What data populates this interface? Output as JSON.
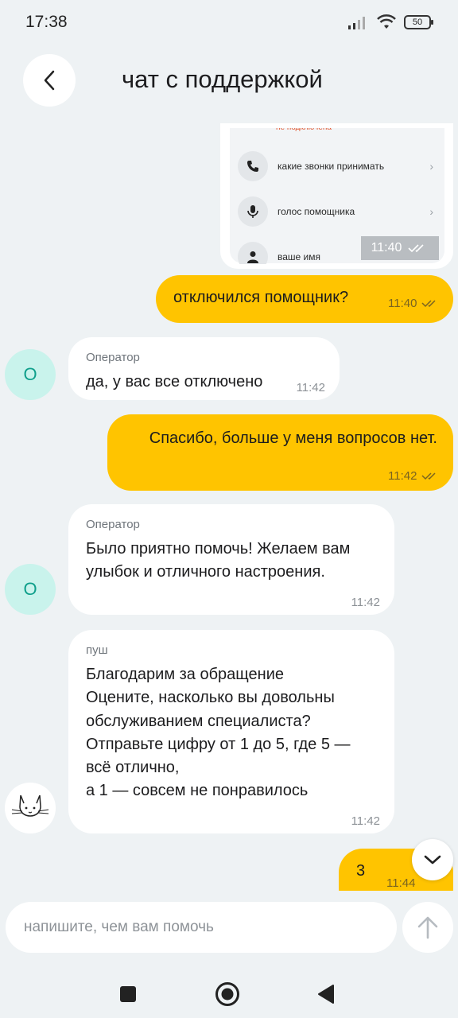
{
  "status_bar": {
    "time": "17:38",
    "battery": "50"
  },
  "header": {
    "title": "чат с поддержкой"
  },
  "screenshot_msg": {
    "top_cut_text": "не подключена",
    "items": [
      {
        "label": "какие звонки принимать",
        "icon": "phone-icon"
      },
      {
        "label": "голос помощника",
        "icon": "microphone-icon"
      },
      {
        "label": "ваше имя",
        "icon": "person-icon"
      }
    ],
    "time": "11:40"
  },
  "messages": [
    {
      "direction": "out",
      "text": "отключился помощник?",
      "time": "11:40"
    },
    {
      "direction": "in",
      "sender": "Оператор",
      "text": "да, у вас все отключено",
      "time": "11:42",
      "avatar": "О"
    },
    {
      "direction": "out",
      "text": "Спасибо, больше у меня вопросов нет.",
      "time": "11:42"
    },
    {
      "direction": "in",
      "sender": "Оператор",
      "text": "Было приятно помочь! Желаем вам улыбок и отличного настроения.",
      "time": "11:42",
      "avatar": "О"
    },
    {
      "direction": "in",
      "sender": "пуш",
      "lines": [
        "Благодарим за обращение",
        "Оцените, насколько вы довольны",
        "обслуживанием специалиста?",
        "Отправьте цифру от 1 до 5, где 5 —",
        "всё отлично,",
        "а 1 — совсем не понравилось"
      ],
      "time": "11:42",
      "avatar_icon": "cat-icon"
    },
    {
      "direction": "out",
      "text": "3",
      "time": "11:44"
    }
  ],
  "input": {
    "placeholder": "напишите, чем вам помочь"
  },
  "colors": {
    "accent": "#ffc400",
    "background": "#eef2f4",
    "operator_avatar": "#c9f3ec"
  }
}
